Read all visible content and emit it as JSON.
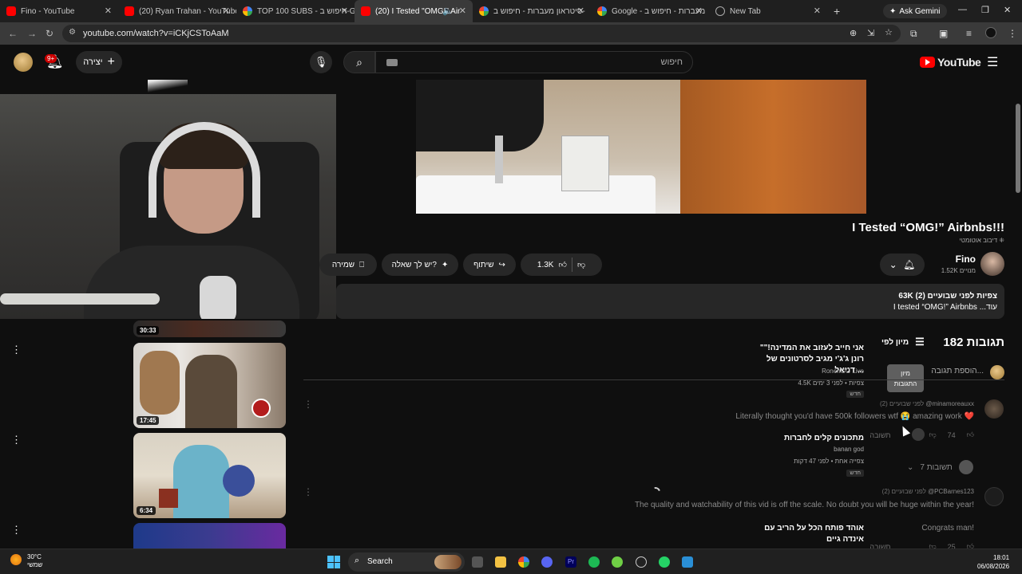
{
  "browser": {
    "tabs": [
      {
        "label": "Fino - YouTube",
        "icon": "youtube-icon"
      },
      {
        "label": "(20) Ryan Trahan - YouTube",
        "icon": "youtube-icon"
      },
      {
        "label": "TOP 100 SUBS - חיפוש ב-Go",
        "icon": "google-icon"
      },
      {
        "label": "(20) I Tested \"OMG!\" Air",
        "icon": "youtube-icon",
        "active": true
      },
      {
        "label": "סיטראון מעברות - חיפוש ב-",
        "icon": "google-icon"
      },
      {
        "label": "Google - מעברות - חיפוש ב",
        "icon": "google-icon"
      },
      {
        "label": "New Tab",
        "icon": "new-tab-icon"
      }
    ],
    "ask_gemini": "Ask Gemini",
    "url": "youtube.com/watch?v=iCKjCSToAaM"
  },
  "yt_header": {
    "notification_count": "9+",
    "create_label": "יצירה",
    "search_placeholder": "חיפוש",
    "logo_text": "YouTube"
  },
  "video": {
    "title": "I Tested “OMG!” Airbnbs!!!",
    "dubbed_label": "דיבוב אוטומטי",
    "channel_name": "Fino",
    "channel_subs": "1.52K מנויים",
    "like_count": "1.3K",
    "share_label": "שיתוף",
    "ask_label": "יש לך שאלה?",
    "save_label": "שמירה",
    "description_stats": "63K צפיות  לפני שבועיים (2)",
    "description_text": "I tested “OMG!” Airbnbs ...עוד"
  },
  "comments": {
    "count_label": "182 תגובות",
    "sort_label": "מיון לפי",
    "add_placeholder": "הוספת תגובה...",
    "tooltip": [
      "מיון",
      "התגובות"
    ],
    "items": [
      {
        "author": "@minamoreauxx",
        "time": "לפני שבועיים (2)",
        "text": "Literally thought you'd have 500k followers wtf 😭 amazing work ❤️",
        "likes": "74",
        "reply_label": "תשובה",
        "replies_label": "7 תשובות"
      },
      {
        "author": "@PCBarnes123",
        "time": "לפני שבועיים (2)",
        "text": "The quality and watchability of this vid is off the scale. No doubt you will be huge within the year!",
        "text2": "Congrats man!",
        "likes": "25",
        "reply_label": "תשובה"
      }
    ]
  },
  "recommendations": [
    {
      "duration": "30:33"
    },
    {
      "title": "\"אני חייב לעזוב את המדינה!\" רונן ג'ג'י מגיב לסרטונים של דניאל ...",
      "channel": "RonenGG Live",
      "meta": "4.5K צפיות • לפני 3 ימים",
      "badge": "חדש",
      "duration": "17:45"
    },
    {
      "title": "מתכונים קלים לחברות",
      "channel": "banan god",
      "meta": "צפייה אחת • לפני 47 דקות",
      "badge": "חדש",
      "duration": "6:34"
    },
    {
      "title": "אוהד פותח הכל על הריב עם אינדה גיים"
    }
  ],
  "taskbar": {
    "weather_temp": "30°C",
    "weather_desc": "שמשי",
    "search_label": "Search",
    "time": "18:01",
    "date": "06/08/2026"
  }
}
